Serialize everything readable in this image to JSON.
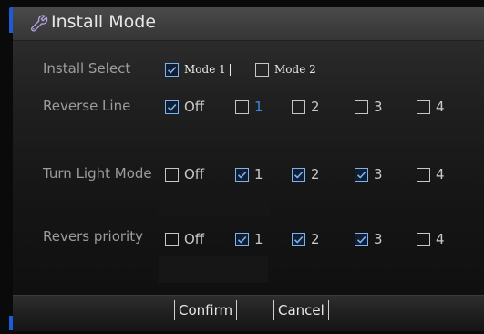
{
  "dialog": {
    "title": "Install Mode",
    "title_icon": "wrench-icon"
  },
  "rows": {
    "install_select": {
      "label": "Install Select",
      "options": [
        {
          "label": "Mode 1",
          "checked": true
        },
        {
          "label": "Mode 2",
          "checked": false
        }
      ]
    },
    "reverse_line": {
      "label": "Reverse Line",
      "options": [
        {
          "label": "Off",
          "checked": true
        },
        {
          "label": "1",
          "checked": false
        },
        {
          "label": "2",
          "checked": false
        },
        {
          "label": "3",
          "checked": false
        },
        {
          "label": "4",
          "checked": false
        }
      ]
    },
    "turn_light_mode": {
      "label": "Turn Light Mode",
      "options": [
        {
          "label": "Off",
          "checked": false
        },
        {
          "label": "1",
          "checked": true
        },
        {
          "label": "2",
          "checked": true
        },
        {
          "label": "3",
          "checked": true
        },
        {
          "label": "4",
          "checked": false
        }
      ]
    },
    "revers_priority": {
      "label": "Revers priority",
      "options": [
        {
          "label": "Off",
          "checked": false
        },
        {
          "label": "1",
          "checked": true
        },
        {
          "label": "2",
          "checked": true
        },
        {
          "label": "3",
          "checked": true
        },
        {
          "label": "4",
          "checked": false
        }
      ]
    }
  },
  "footer": {
    "confirm_label": "Confirm",
    "cancel_label": "Cancel"
  },
  "colors": {
    "accent": "#1d5bd8",
    "check": "#7fb1ea",
    "highlight_text": "#3d86d6"
  }
}
